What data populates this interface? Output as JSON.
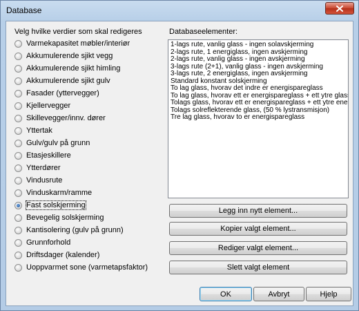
{
  "window": {
    "title": "Database",
    "close_icon": "close-x-icon"
  },
  "left_group": {
    "label": "Velg hvilke verdier som skal redigeres",
    "options": [
      "Varmekapasitet møbler/interiør",
      "Akkumulerende sjikt vegg",
      "Akkumulerende sjikt himling",
      "Akkumulerende sjikt gulv",
      "Fasader (yttervegger)",
      "Kjellervegger",
      "Skillevegger/innv. dører",
      "Yttertak",
      "Gulv/gulv på grunn",
      "Etasjeskillere",
      "Ytterdører",
      "Vindusrute",
      "Vinduskarm/ramme",
      "Fast solskjerming",
      "Bevegelig solskjerming",
      "Kantisolering (gulv på grunn)",
      "Grunnforhold",
      "Driftsdager (kalender)",
      "Uoppvarmet sone (varmetapsfaktor)"
    ],
    "selected": "Fast solskjerming"
  },
  "right_group": {
    "label": "Databaseelementer:",
    "items": [
      "1-lags rute, vanlig glass - ingen solavskjerming",
      "2-lags rute, 1 energiglass, ingen avskjerming",
      "2-lags rute, vanlig glass - ingen avskjerming",
      "3-lags rute (2+1), vanlig glass - ingen avskjerming",
      "3-lags rute, 2 energiglass, ingen avskjerming",
      "Standard konstant solskjerming",
      "To lag glass, hvorav det indre er energispareglass",
      "To lag glass, hvorav ett er energispareglass + ett ytre glass i",
      "Tolags glass, hvorav ett er energispareglass + ett ytre energi",
      "Tolags solreflekterende glass, (50 % lystransmisjon)",
      "Tre lag glass, hvorav to er energispareglass"
    ]
  },
  "buttons": {
    "add": "Legg inn nytt element...",
    "copy": "Kopier valgt element...",
    "edit": "Rediger valgt element...",
    "delete": "Slett valgt element",
    "ok": "OK",
    "cancel": "Avbryt",
    "help": "Hjelp"
  }
}
